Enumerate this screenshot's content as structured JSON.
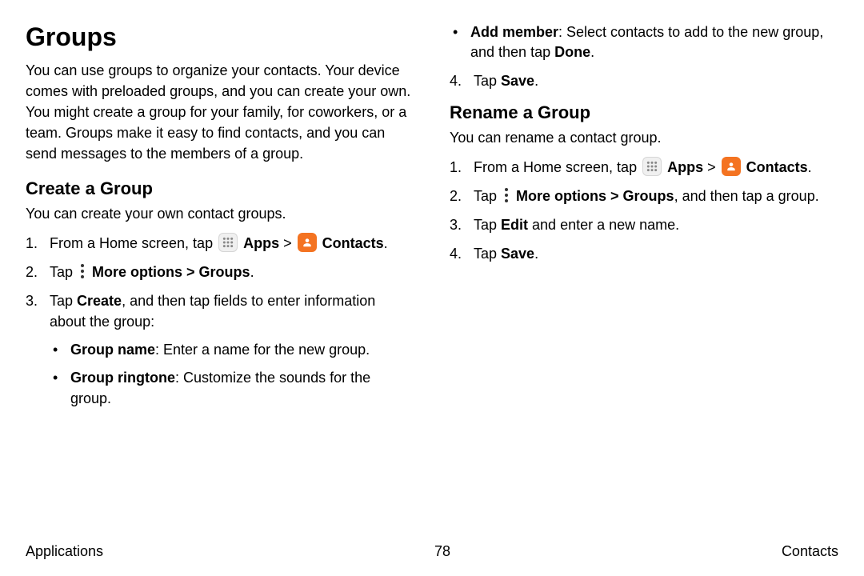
{
  "title": "Groups",
  "intro": "You can use groups to organize your contacts. Your device comes with preloaded groups, and you can create your own. You might create a group for your family, for coworkers, or a team. Groups make it easy to find contacts, and you can send messages to the members of a group.",
  "create": {
    "heading": "Create a Group",
    "sub": "You can create your own contact groups.",
    "step1_pre": "From a Home screen, tap ",
    "apps_label": "Apps",
    "arrow": " > ",
    "contacts_label": "Contacts",
    "period": ".",
    "step2_pre": "Tap ",
    "step2_more": "More options > Groups",
    "step3_pre": "Tap ",
    "step3_bold": "Create",
    "step3_post": ", and then tap fields to enter information about the group:",
    "bullet1_bold": "Group name",
    "bullet1_rest": ": Enter a name for the new group.",
    "bullet2_bold": "Group ringtone",
    "bullet2_rest": ": Customize the sounds for the group."
  },
  "right": {
    "bullet3_bold": "Add member",
    "bullet3_mid": ": Select contacts to add to the new group, and then tap ",
    "bullet3_done": "Done",
    "step4_pre": "Tap ",
    "step4_bold": "Save"
  },
  "rename": {
    "heading": "Rename a Group",
    "sub": "You can rename a contact group.",
    "step1_pre": "From a Home screen, tap ",
    "apps_label": "Apps",
    "arrow": " > ",
    "contacts_label": "Contacts",
    "period": ".",
    "step2_pre": "Tap ",
    "step2_more": "More options > Groups",
    "step2_post": ", and then tap a group.",
    "step3_pre": "Tap ",
    "step3_bold": "Edit",
    "step3_post": " and enter a new name.",
    "step4_pre": "Tap ",
    "step4_bold": "Save"
  },
  "footer": {
    "left": "Applications",
    "center": "78",
    "right": "Contacts"
  }
}
